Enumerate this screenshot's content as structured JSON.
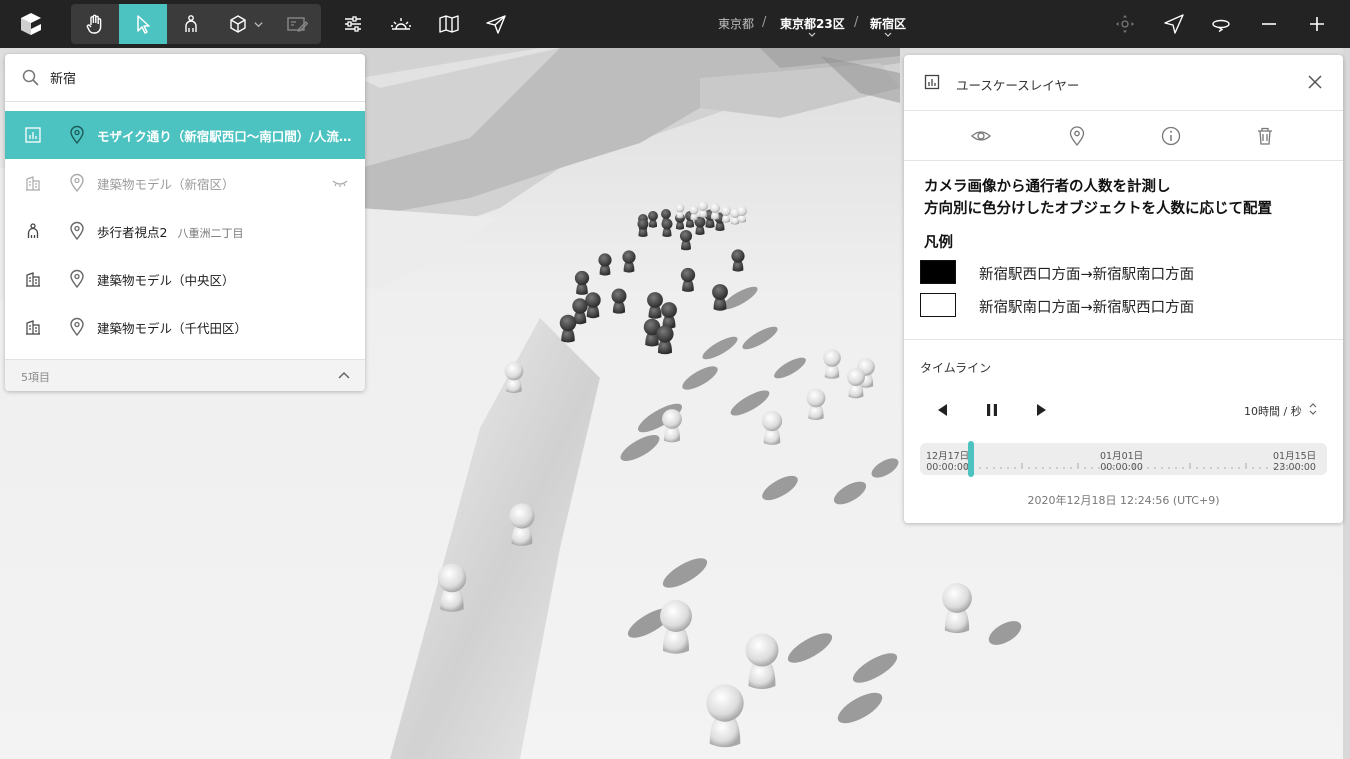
{
  "breadcrumb": {
    "items": [
      {
        "label": "東京都"
      },
      {
        "label": "東京都23区"
      },
      {
        "label": "新宿区"
      }
    ],
    "separator": "/"
  },
  "search": {
    "query": "新宿",
    "results": [
      {
        "label": "モザイク通り（新宿駅西口〜南口間）/人流データ",
        "icon": "usecase-icon",
        "selected": true
      },
      {
        "label": "建築物モデル（新宿区）",
        "icon": "building-icon",
        "hidden": true
      },
      {
        "label": "歩行者視点2",
        "sub": "八重洲二丁目",
        "icon": "pedestrian-icon"
      },
      {
        "label": "建築物モデル（中央区）",
        "icon": "building-icon"
      },
      {
        "label": "建築物モデル（千代田区）",
        "icon": "building-icon"
      }
    ],
    "count_label": "5項目"
  },
  "usecase_panel": {
    "title": "ユースケースレイヤー",
    "description_line1": "カメラ画像から通行者の人数を計測し",
    "description_line2": "方向別に色分けしたオブジェクトを人数に応じて配置",
    "legend_title": "凡例",
    "legend": [
      {
        "label": "新宿駅西口方面→新宿駅南口方面",
        "color": "#000000"
      },
      {
        "label": "新宿駅南口方面→新宿駅西口方面",
        "color": "#ffffff"
      }
    ]
  },
  "timeline": {
    "title": "タイムライン",
    "speed": "10時間 / 秒",
    "ticks": [
      {
        "date": "12月17日",
        "time": "00:00:00"
      },
      {
        "date": "01月01日",
        "time": "00:00:00"
      },
      {
        "date": "01月15日",
        "time": "23:00:00"
      }
    ],
    "position": 0.01,
    "current": "2020年12月18日 12:24:56 (UTC+9)"
  },
  "colors": {
    "accent": "#4cc3c1",
    "topbar": "#232323"
  }
}
